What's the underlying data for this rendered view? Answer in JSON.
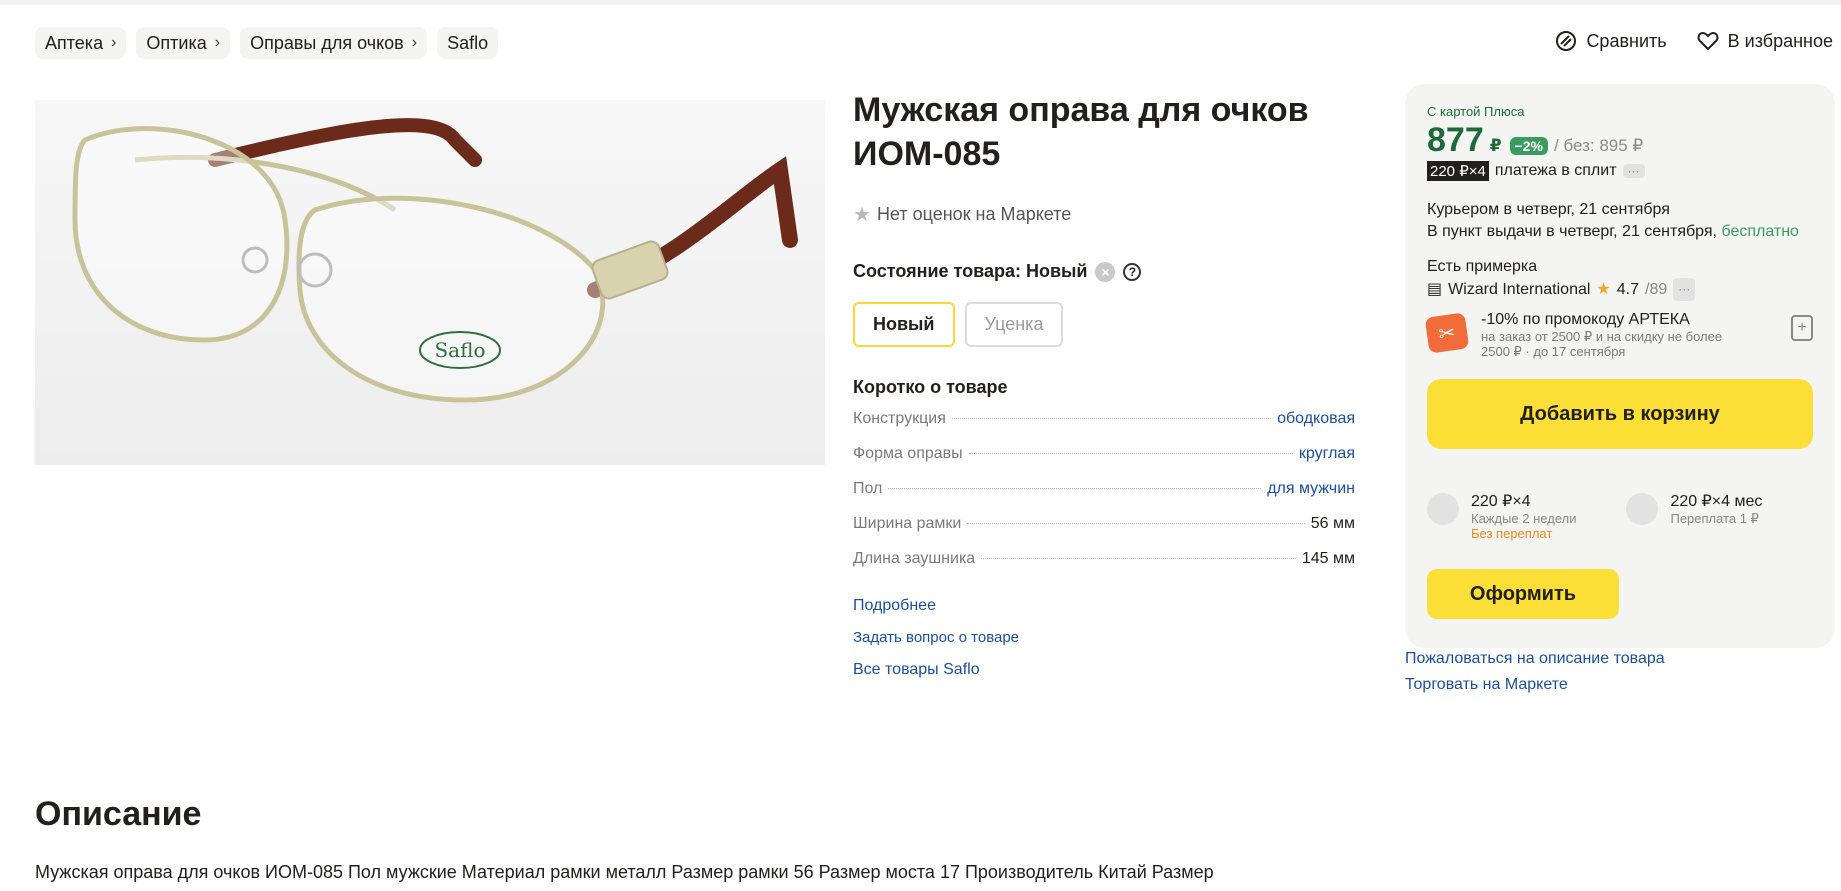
{
  "breadcrumbs": [
    "Аптека",
    "Оптика",
    "Оправы для очков",
    "Saflo"
  ],
  "top_actions": {
    "compare": "Сравнить",
    "favorite": "В избранное"
  },
  "product": {
    "title_line1": "Мужская оправа для очков",
    "title_line2": "ИОМ-085",
    "rating": "Нет оценок на Маркете",
    "condition_label": "Состояние товара: Новый",
    "condition_options": [
      "Новый",
      "Уценка"
    ],
    "brief_title": "Коротко о товаре",
    "specs": [
      {
        "k": "Конструкция",
        "v": "ободковая"
      },
      {
        "k": "Форма оправы",
        "v": "круглая"
      },
      {
        "k": "Пол",
        "v": "для мужчин"
      },
      {
        "k": "Ширина рамки",
        "v": "56 мм"
      },
      {
        "k": "Длина заушника",
        "v": "145 мм"
      }
    ],
    "links": [
      "Подробнее",
      "Задать вопрос о товаре",
      "Все товары Saflo"
    ],
    "brand_on_frame": "Saflo"
  },
  "card": {
    "plus_label": "С картой Плюса",
    "price": "877",
    "currency": "₽",
    "discount": "−2%",
    "old_price": "/ без: 895 ₽",
    "split_badge": "220 ₽×4",
    "split_text": "платежа в сплит",
    "more": "···",
    "delivery_courier": "Курьером в четверг, 21 сентября",
    "delivery_pickup": "В пункт выдачи в четверг, 21 сентября,",
    "delivery_free": "бесплатно",
    "fitting": "Есть примерка",
    "seller": "Wizard International",
    "seller_rating": "4.7",
    "seller_reviews": "/89",
    "promo_title": "-10% по промокоду АРТЕКА",
    "promo_sub": "на заказ от 2500 ₽ и на скидку не более 2500 ₽ · до 17 сентября",
    "cart_button": "Добавить в корзину",
    "plans": [
      {
        "t1": "220 ₽×4",
        "t2": "Каждые 2 недели",
        "t3": "Без переплат"
      },
      {
        "t1": "220 ₽×4 мес",
        "t2": "Переплата 1 ₽",
        "t3": ""
      }
    ],
    "order_button": "Оформить",
    "colors": {
      "green": "#1d6b3c",
      "yellow": "#fcdf36"
    }
  },
  "right_links": [
    "Пожаловаться на описание товара",
    "Торговать на Маркете"
  ],
  "description": {
    "title": "Описание",
    "text": "Мужская оправа для очков ИОМ-085 Пол мужские Материал рамки металл Размер рамки 56 Размер моста 17 Производитель Китай Размер"
  }
}
